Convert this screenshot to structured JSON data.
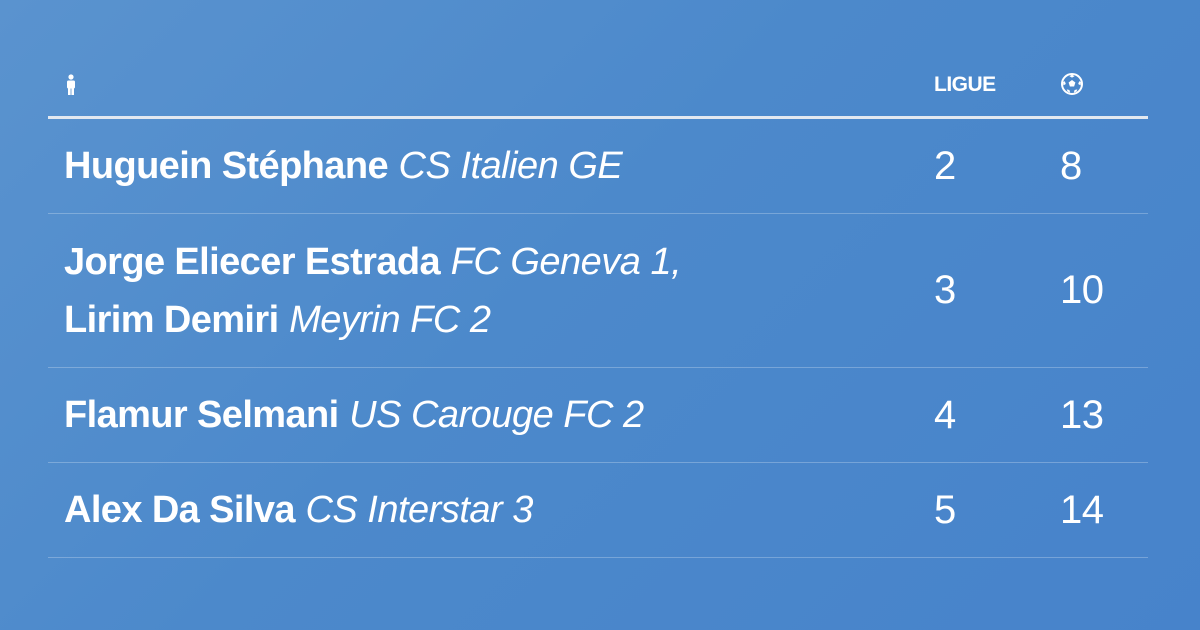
{
  "header": {
    "person_icon": "person-icon",
    "ligue_label": "LIGUE",
    "ball_icon": "soccer-ball-icon"
  },
  "rows": [
    {
      "players": [
        {
          "name": "Huguein Stéphane",
          "club": "CS Italien GE"
        }
      ],
      "ligue": "2",
      "goals": "8"
    },
    {
      "players": [
        {
          "name": "Jorge Eliecer Estrada",
          "club": "FC Geneva 1,"
        },
        {
          "name": "Lirim Demiri",
          "club": "Meyrin FC 2"
        }
      ],
      "ligue": "3",
      "goals": "10"
    },
    {
      "players": [
        {
          "name": "Flamur Selmani",
          "club": "US Carouge FC 2"
        }
      ],
      "ligue": "4",
      "goals": "13"
    },
    {
      "players": [
        {
          "name": "Alex Da Silva",
          "club": "CS Interstar 3"
        }
      ],
      "ligue": "5",
      "goals": "14"
    }
  ],
  "colors": {
    "background": "#4c89cb",
    "text": "#ffffff",
    "header_rule": "#e2e8f0"
  }
}
